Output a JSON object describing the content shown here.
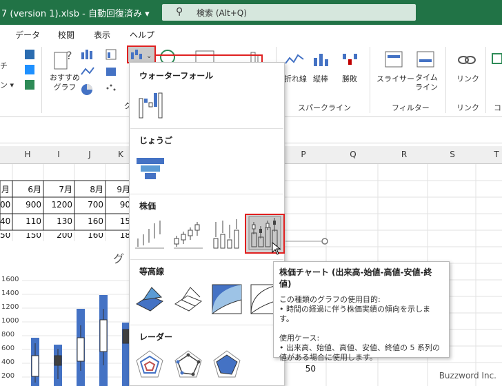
{
  "titlebar": {
    "doc_title": "7 (version 1).xlsb  -  自動回復済み  ▾",
    "search_placeholder": "検索 (Alt+Q)"
  },
  "menu": [
    "データ",
    "校閲",
    "表示",
    "ヘルプ"
  ],
  "ribbon": {
    "recommended_charts": "おすすめ\nグラフ",
    "group_chart_partial": "グ",
    "sparkline_items": [
      "折れ線",
      "縦棒",
      "勝敗"
    ],
    "sparkline_group": "スパークライン",
    "slicer": "スライサー",
    "timeline": "タイム\nライン",
    "filter_group": "フィルター",
    "link": "リンク",
    "link_group": "リンク",
    "comment_partial": "コ",
    "left_partial": "チ\nン ▾"
  },
  "columns": [
    "H",
    "I",
    "J",
    "K",
    "P",
    "Q",
    "R",
    "S",
    "T"
  ],
  "table": {
    "header": [
      "月",
      "6月",
      "7月",
      "8月",
      "9月"
    ],
    "rows": [
      [
        "00",
        "900",
        "1200",
        "700",
        "90"
      ],
      [
        "40",
        "110",
        "130",
        "160",
        "15"
      ],
      [
        "50",
        "150",
        "200",
        "160",
        "18"
      ]
    ]
  },
  "chart": {
    "title_partial": "グ",
    "y_ticks": [
      "1600",
      "1400",
      "1200",
      "1000",
      "800",
      "600",
      "400",
      "200"
    ],
    "right_axis_tick": "50"
  },
  "dropdown": {
    "sections": [
      "ウォーターフォール",
      "じょうご",
      "株価",
      "等高線",
      "レーダー"
    ]
  },
  "tooltip": {
    "title": "株価チャート (出来高-始値-高値-安値-終値)",
    "lines": [
      "この種類のグラフの使用目的:",
      "• 時間の経過に伴う株価実績の傾向を示しま",
      "す。",
      "",
      "使用ケース:",
      "• 出来高、始値、高値、安値、終値の 5 系列の",
      "値がある場合に使用します。"
    ]
  },
  "watermark": "Buzzword Inc.",
  "colors": {
    "excel_green": "#217346",
    "highlight_red": "#e02020",
    "bar_blue": "#4472c4"
  }
}
